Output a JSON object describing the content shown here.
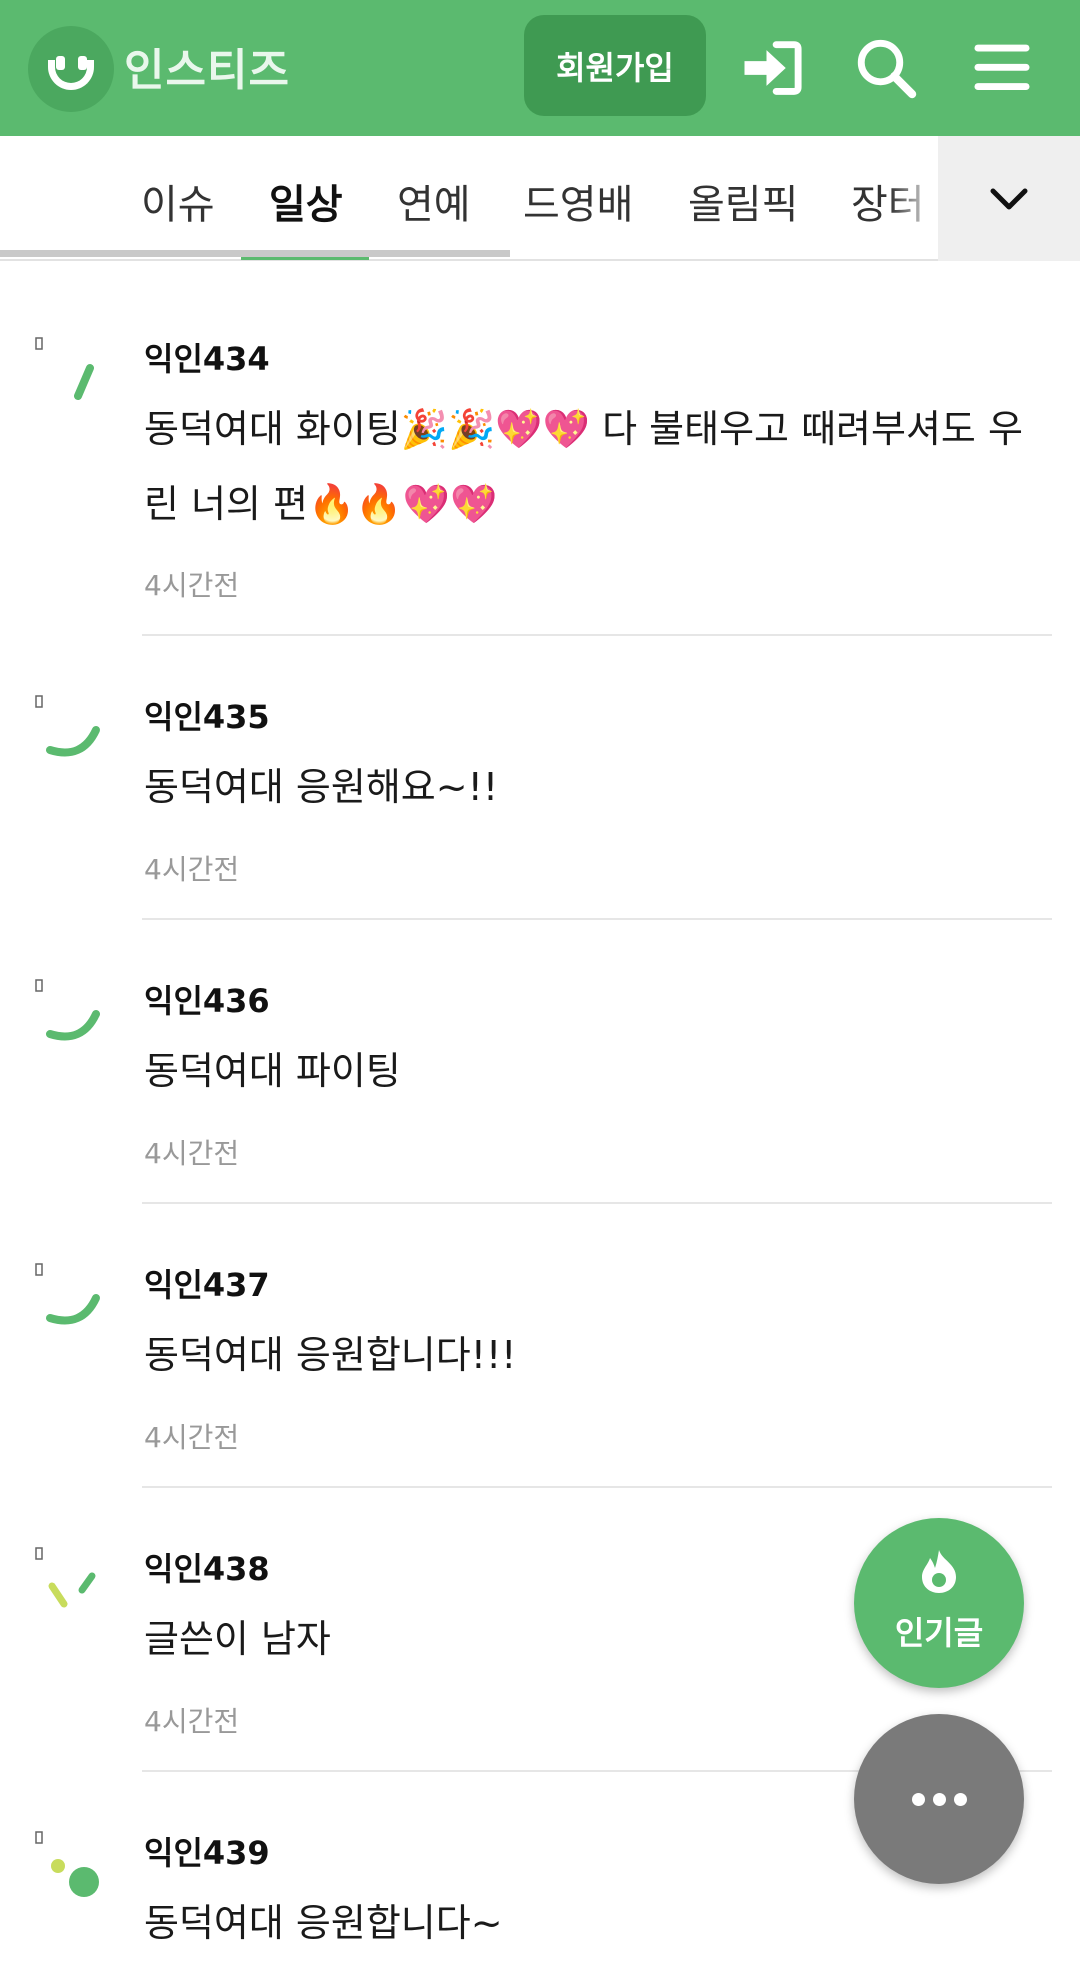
{
  "header": {
    "brand": "인스티즈",
    "join_label": "회원가입",
    "icons": [
      "login-icon",
      "search-icon",
      "menu-icon"
    ],
    "color": "#5bba6f"
  },
  "tabs": {
    "items": [
      {
        "label": "이슈",
        "active": false
      },
      {
        "label": "일상",
        "active": true
      },
      {
        "label": "연예",
        "active": false
      },
      {
        "label": "드영배",
        "active": false
      },
      {
        "label": "올림픽",
        "active": false
      },
      {
        "label": "장터",
        "active": false
      }
    ],
    "more_icon": "chevron-down-icon"
  },
  "comments": [
    {
      "nick": "익인434",
      "text": "동덕여대 화이팅🎉🎉💖💖 다 불태우고 때려부셔도 우린 너의 편🔥🔥💖💖",
      "time": "4시간전"
    },
    {
      "nick": "익인435",
      "text": "동덕여대 응원해요~!!",
      "time": "4시간전"
    },
    {
      "nick": "익인436",
      "text": "동덕여대 파이팅",
      "time": "4시간전"
    },
    {
      "nick": "익인437",
      "text": "동덕여대 응원합니다!!!",
      "time": "4시간전"
    },
    {
      "nick": "익인438",
      "text": "글쓴이 남자",
      "time": "4시간전"
    },
    {
      "nick": "익인439",
      "text": "동덕여대 응원합니다~",
      "time": ""
    }
  ],
  "fab": {
    "popular_label": "인기글",
    "popular_icon": "flame-icon",
    "more_icon": "more-dots-icon"
  }
}
